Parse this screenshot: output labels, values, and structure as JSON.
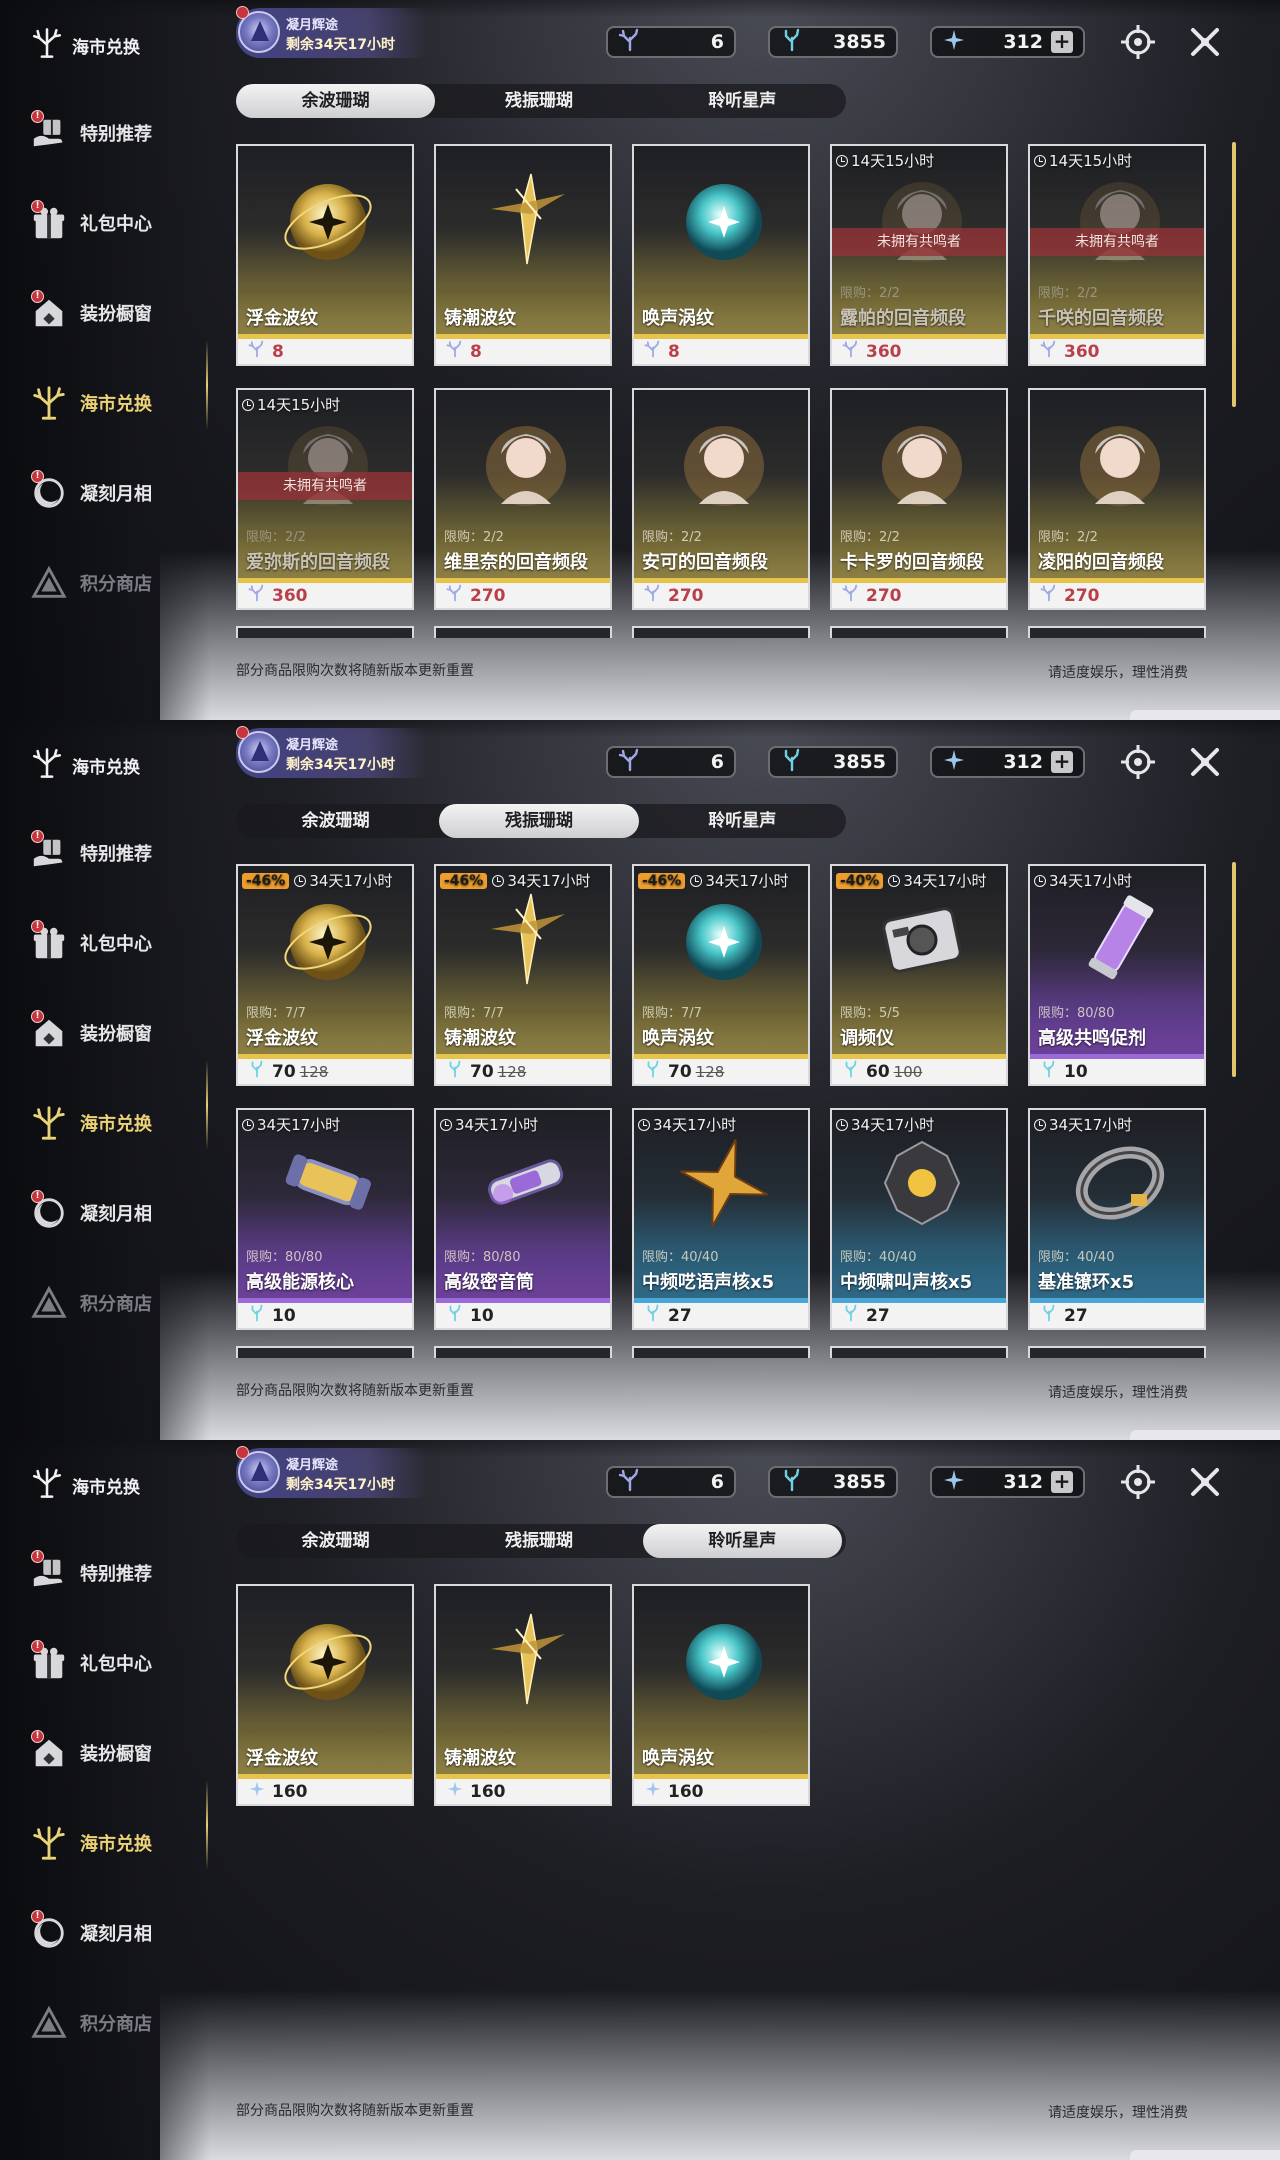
{
  "colors": {
    "accent": "#ead277",
    "price_red": "#b9404a",
    "discount": "#ee9e2c",
    "miss_banner": "#963237"
  },
  "sidebar": {
    "title": "海市兑换",
    "items": [
      {
        "label": "特别推荐",
        "icon": "gift-hand-icon",
        "badge": "!"
      },
      {
        "label": "礼包中心",
        "icon": "gift-box-icon",
        "badge": "!"
      },
      {
        "label": "装扮橱窗",
        "icon": "outfit-house-icon",
        "badge": "!"
      },
      {
        "label": "海市兑换",
        "icon": "coral-icon",
        "badge": ""
      },
      {
        "label": "凝刻月相",
        "icon": "moon-seal-icon",
        "badge": "!"
      },
      {
        "label": "积分商店",
        "icon": "triangle-icon",
        "badge": ""
      }
    ]
  },
  "event": {
    "title": "凝月辉途",
    "remaining": "剩余34天17小时"
  },
  "currency": {
    "wave_coral": "6",
    "echo_coral": "3855",
    "star_sound": "312",
    "plus": "+"
  },
  "tabs": [
    "余波珊瑚",
    "残振珊瑚",
    "聆听星声"
  ],
  "footer": {
    "left": "部分商品限购次数将随新版本更新重置",
    "right": "请适度娱乐，理性消费"
  },
  "panels": [
    {
      "selected_tab": 0,
      "cards": [
        {
          "name": "浮金波纹",
          "price": "8",
          "price_style": "red",
          "currency": "wave",
          "art": "gold-orb-icon"
        },
        {
          "name": "铸潮波纹",
          "price": "8",
          "price_style": "red",
          "currency": "wave",
          "art": "gold-blade-icon"
        },
        {
          "name": "唤声涡纹",
          "price": "8",
          "price_style": "red",
          "currency": "wave",
          "art": "teal-orb-icon"
        },
        {
          "name": "露帕的回音频段",
          "price": "360",
          "price_style": "red",
          "currency": "wave",
          "timer": "14天15小时",
          "limit": "限购：2/2",
          "miss": "未拥有共鸣者",
          "art": "portrait-icon"
        },
        {
          "name": "千咲的回音频段",
          "price": "360",
          "price_style": "red",
          "currency": "wave",
          "timer": "14天15小时",
          "limit": "限购：2/2",
          "miss": "未拥有共鸣者",
          "art": "portrait-icon"
        },
        {
          "name": "爱弥斯的回音频段",
          "price": "360",
          "price_style": "red",
          "currency": "wave",
          "timer": "14天15小时",
          "limit": "限购：2/2",
          "miss": "未拥有共鸣者",
          "art": "portrait-icon"
        },
        {
          "name": "维里奈的回音频段",
          "price": "270",
          "price_style": "red",
          "currency": "wave",
          "limit": "限购：2/2",
          "art": "portrait-icon"
        },
        {
          "name": "安可的回音频段",
          "price": "270",
          "price_style": "red",
          "currency": "wave",
          "limit": "限购：2/2",
          "art": "portrait-icon"
        },
        {
          "name": "卡卡罗的回音频段",
          "price": "270",
          "price_style": "red",
          "currency": "wave",
          "limit": "限购：2/2",
          "art": "portrait-icon"
        },
        {
          "name": "凌阳的回音频段",
          "price": "270",
          "price_style": "red",
          "currency": "wave",
          "limit": "限购：2/2",
          "art": "portrait-icon"
        }
      ]
    },
    {
      "selected_tab": 1,
      "cards": [
        {
          "name": "浮金波纹",
          "price": "70",
          "old_price": "128",
          "discount": "-46%",
          "timer": "34天17小时",
          "limit": "限购：7/7",
          "currency": "echo",
          "art": "gold-orb-icon"
        },
        {
          "name": "铸潮波纹",
          "price": "70",
          "old_price": "128",
          "discount": "-46%",
          "timer": "34天17小时",
          "limit": "限购：7/7",
          "currency": "echo",
          "art": "gold-blade-icon"
        },
        {
          "name": "唤声涡纹",
          "price": "70",
          "old_price": "128",
          "discount": "-46%",
          "timer": "34天17小时",
          "limit": "限购：7/7",
          "currency": "echo",
          "art": "teal-orb-icon"
        },
        {
          "name": "调频仪",
          "price": "60",
          "old_price": "100",
          "discount": "-40%",
          "timer": "34天17小时",
          "limit": "限购：5/5",
          "currency": "echo",
          "art": "tuner-device-icon"
        },
        {
          "name": "高级共鸣促剂",
          "price": "10",
          "timer": "34天17小时",
          "limit": "限购：80/80",
          "currency": "echo",
          "rarity": "purple",
          "art": "vial-icon"
        },
        {
          "name": "高级能源核心",
          "price": "10",
          "timer": "34天17小时",
          "limit": "限购：80/80",
          "currency": "echo",
          "rarity": "purple",
          "art": "energy-core-icon"
        },
        {
          "name": "高级密音筒",
          "price": "10",
          "timer": "34天17小时",
          "limit": "限购：80/80",
          "currency": "echo",
          "rarity": "purple",
          "art": "sealed-tube-icon"
        },
        {
          "name": "中频呓语声核x5",
          "price": "27",
          "timer": "34天17小时",
          "limit": "限购：40/40",
          "currency": "echo",
          "rarity": "blue",
          "art": "star-core-icon"
        },
        {
          "name": "中频啸叫声核x5",
          "price": "27",
          "timer": "34天17小时",
          "limit": "限购：40/40",
          "currency": "echo",
          "rarity": "blue",
          "art": "dark-core-icon"
        },
        {
          "name": "基准镣环x5",
          "price": "27",
          "timer": "34天17小时",
          "limit": "限购：40/40",
          "currency": "echo",
          "rarity": "blue",
          "art": "ring-icon"
        }
      ]
    },
    {
      "selected_tab": 2,
      "cards": [
        {
          "name": "浮金波纹",
          "price": "160",
          "currency": "star",
          "art": "gold-orb-icon"
        },
        {
          "name": "铸潮波纹",
          "price": "160",
          "currency": "star",
          "art": "gold-blade-icon"
        },
        {
          "name": "唤声涡纹",
          "price": "160",
          "currency": "star",
          "art": "teal-orb-icon"
        }
      ]
    }
  ]
}
